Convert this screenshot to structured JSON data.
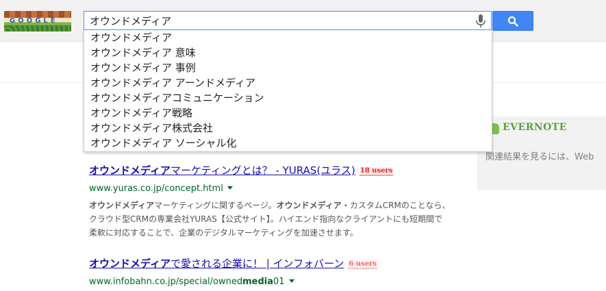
{
  "search": {
    "query": "オウンドメディア"
  },
  "doodle": {
    "text": "GOOGLE"
  },
  "suggestions": [
    "オウンドメディア",
    "オウンドメディア 意味",
    "オウンドメディア 事例",
    "オウンドメディア アーンドメディア",
    "オウンドメディアコミュニケーション",
    "オウンドメディア戦略",
    "オウンドメディア株式会社",
    "オウンドメディア ソーシャル化"
  ],
  "evernote": {
    "title": "EVERNOTE",
    "text": "関連結果を見るには、Web"
  },
  "results": [
    {
      "title_bold": "オウンドメディア",
      "title_rest": "マーケティングとは？ - YURAS(ユラス)",
      "users": "18 users",
      "url": "www.yuras.co.jp/concept.html",
      "snippet": [
        {
          "b1": "オウンドメディア",
          "t1": "マーケティングに関するページ。",
          "b2": "オウンドメディア",
          "t2": "・カスタムCRMのことなら、"
        },
        {
          "t1": "クラウド型CRMの専業会社YURAS【公式サイト】。ハイエンド指向なクライアントにも短期間で"
        },
        {
          "t1": "柔軟に対応することで、企業のデジタルマーケティングを加速させます。"
        }
      ]
    },
    {
      "title_bold": "オウンドメディア",
      "title_rest": "で愛される企業に！ | インフォバーン",
      "users": "6 users",
      "url_pre": "www.infobahn.co.jp/special/owned",
      "url_bold": "media",
      "url_post": "01"
    }
  ]
}
